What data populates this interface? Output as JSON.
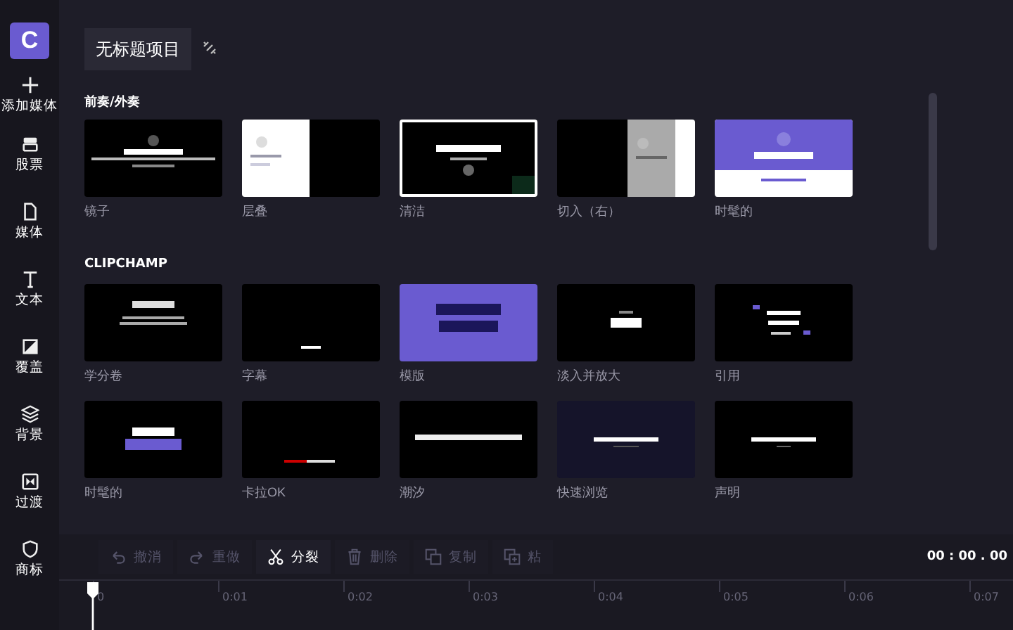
{
  "sidebar": {
    "logo": "C",
    "items": [
      {
        "kind": "add",
        "label": "添加媒体"
      },
      {
        "kind": "stock",
        "label": "股票"
      },
      {
        "kind": "file",
        "label": "媒体"
      },
      {
        "kind": "text",
        "label": "文本"
      },
      {
        "kind": "overlay",
        "label": "覆盖"
      },
      {
        "kind": "layers",
        "label": "背景"
      },
      {
        "kind": "transition",
        "label": "过渡"
      },
      {
        "kind": "shield",
        "label": "商标"
      }
    ]
  },
  "project": {
    "title": "无标题项目"
  },
  "sections": [
    {
      "heading": "前奏/外奏",
      "templates": [
        {
          "label": "镜子",
          "selected": false
        },
        {
          "label": "层叠",
          "selected": false
        },
        {
          "label": "清洁",
          "selected": true
        },
        {
          "label": "切入（右）",
          "selected": false
        },
        {
          "label": "时髦的",
          "selected": false
        }
      ]
    },
    {
      "heading": "CLIPCHAMP",
      "templates": [
        {
          "label": "学分卷",
          "selected": false
        },
        {
          "label": "字幕",
          "selected": false
        },
        {
          "label": "模版",
          "selected": false
        },
        {
          "label": "淡入并放大",
          "selected": false
        },
        {
          "label": "引用",
          "selected": false
        },
        {
          "label": "时髦的",
          "selected": false
        },
        {
          "label": "卡拉OK",
          "selected": false
        },
        {
          "label": "潮汐",
          "selected": false
        },
        {
          "label": "快速浏览",
          "selected": false
        },
        {
          "label": "声明",
          "selected": false
        }
      ]
    }
  ],
  "toolbar": [
    {
      "kind": "undo",
      "label": "撤消",
      "disabled": true
    },
    {
      "kind": "redo",
      "label": "重做",
      "disabled": true
    },
    {
      "kind": "split",
      "label": "分裂",
      "disabled": false
    },
    {
      "kind": "delete",
      "label": "删除",
      "disabled": true
    },
    {
      "kind": "copy",
      "label": "复制",
      "disabled": true
    },
    {
      "kind": "paste",
      "label": "粘",
      "disabled": true
    }
  ],
  "time": "00 : 00 . 00",
  "timeline": {
    "ticks": [
      "0",
      "0:01",
      "0:02",
      "0:03",
      "0:04",
      "0:05",
      "0:06",
      "0:07"
    ]
  }
}
